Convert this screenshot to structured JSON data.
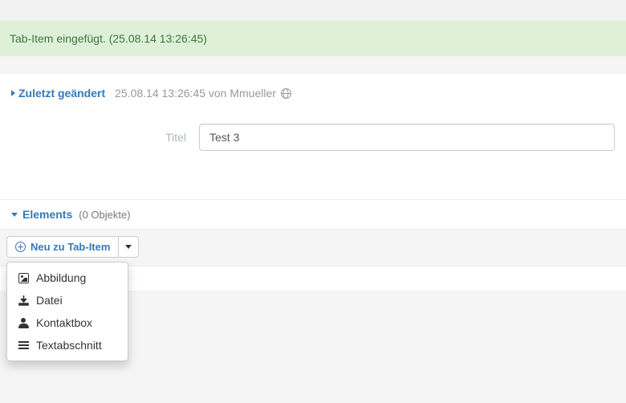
{
  "alert": {
    "text": "Tab-Item eingefügt. (25.08.14 13:26:45)"
  },
  "lastmod": {
    "link_label": "Zuletzt geändert",
    "meta": "25.08.14 13:26:45 von Mmueller"
  },
  "form": {
    "title_label": "Titel",
    "title_value": "Test 3"
  },
  "elements": {
    "heading": "Elements",
    "count": "(0 Objekte)"
  },
  "add": {
    "button_label": "Neu zu Tab-Item",
    "menu": {
      "image": "Abbildung",
      "file": "Datei",
      "contact": "Kontaktbox",
      "text": "Textabschnitt"
    }
  }
}
